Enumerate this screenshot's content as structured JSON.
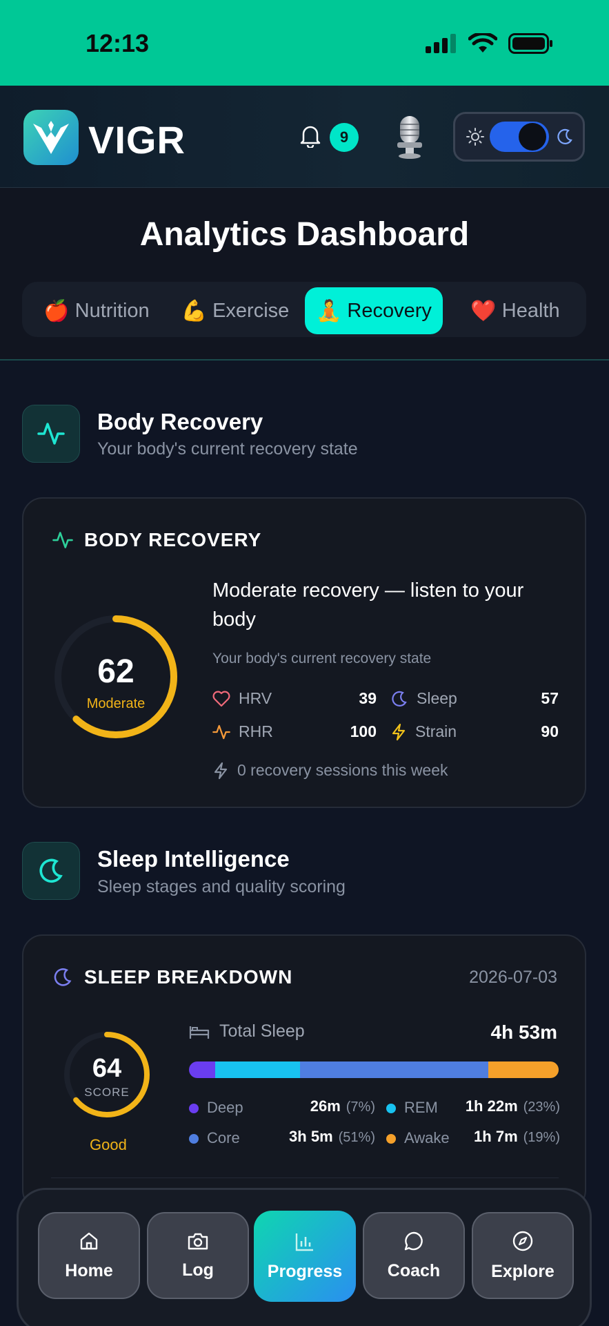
{
  "status_bar": {
    "time": "12:13"
  },
  "header": {
    "brand": "VIGR",
    "notification_count": "9"
  },
  "page": {
    "title": "Analytics Dashboard",
    "tabs": [
      {
        "emoji": "🍎",
        "label": "Nutrition",
        "active": false
      },
      {
        "emoji": "💪",
        "label": "Exercise",
        "active": false
      },
      {
        "emoji": "🧘",
        "label": "Recovery",
        "active": true
      },
      {
        "emoji": "❤️",
        "label": "Health",
        "active": false
      }
    ]
  },
  "body_recovery_section": {
    "title": "Body Recovery",
    "subtitle": "Your body's current recovery state"
  },
  "body_recovery_card": {
    "heading": "BODY RECOVERY",
    "score": "62",
    "score_label": "Moderate",
    "score_value": 62,
    "headline": "Moderate recovery — listen to your body",
    "subtext": "Your body's current recovery state",
    "metrics": {
      "hrv": {
        "label": "HRV",
        "value": "39"
      },
      "sleep": {
        "label": "Sleep",
        "value": "57"
      },
      "rhr": {
        "label": "RHR",
        "value": "100"
      },
      "strain": {
        "label": "Strain",
        "value": "90"
      }
    },
    "sessions": "0 recovery sessions this week"
  },
  "sleep_section": {
    "title": "Sleep Intelligence",
    "subtitle": "Sleep stages and quality scoring"
  },
  "sleep_card": {
    "heading": "SLEEP BREAKDOWN",
    "date": "2026-07-03",
    "score": "64",
    "score_caption": "SCORE",
    "score_value": 64,
    "quality": "Good",
    "total_label": "Total Sleep",
    "total_value": "4h 53m",
    "stages": [
      {
        "name": "Deep",
        "duration": "26m",
        "pct": "(7%)",
        "fraction": 0.07,
        "color": "#6a3df0"
      },
      {
        "name": "REM",
        "duration": "1h 22m",
        "pct": "(23%)",
        "fraction": 0.23,
        "color": "#18c2f0"
      },
      {
        "name": "Core",
        "duration": "3h 5m",
        "pct": "(51%)",
        "fraction": 0.51,
        "color": "#4f7ee0"
      },
      {
        "name": "Awake",
        "duration": "1h 7m",
        "pct": "(19%)",
        "fraction": 0.19,
        "color": "#f5a02a"
      }
    ]
  },
  "bottom_nav": {
    "items": [
      {
        "label": "Home",
        "icon": "home-icon"
      },
      {
        "label": "Log",
        "icon": "camera-icon"
      },
      {
        "label": "Progress",
        "icon": "bar-chart-icon",
        "active": true
      },
      {
        "label": "Coach",
        "icon": "chat-icon"
      },
      {
        "label": "Explore",
        "icon": "compass-icon"
      }
    ]
  },
  "colors": {
    "accent_teal": "#00f0d8",
    "status_green": "#00c896",
    "score_yellow": "#f2b418"
  }
}
